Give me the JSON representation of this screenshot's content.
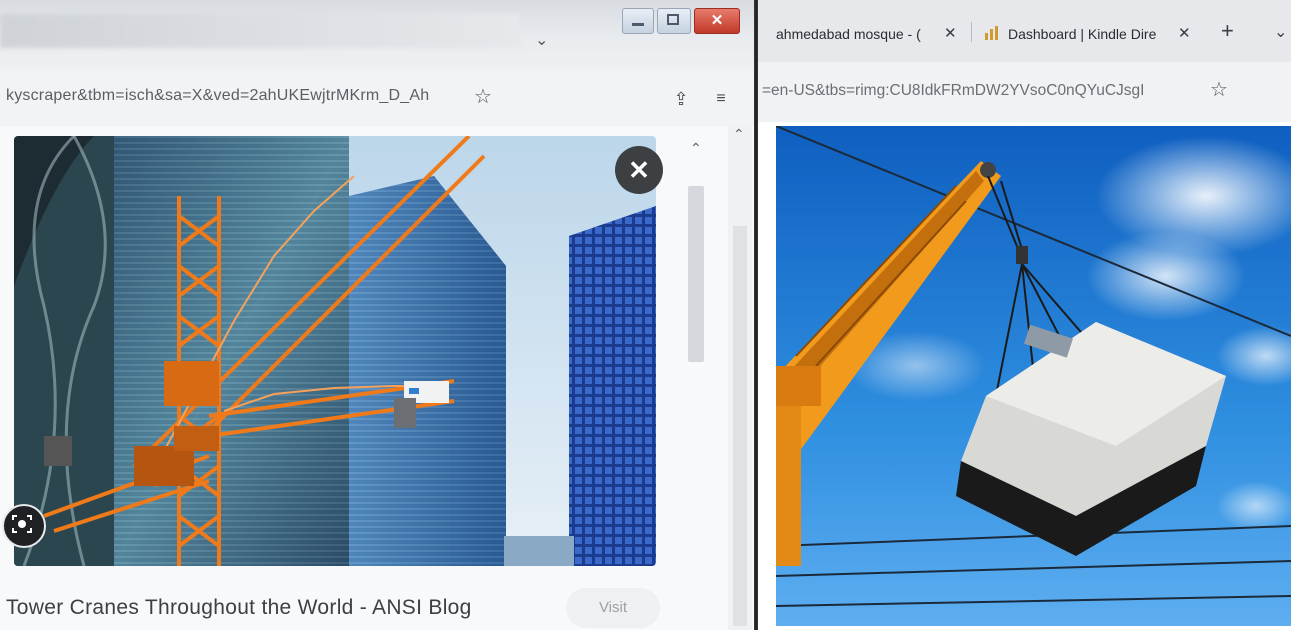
{
  "left_window": {
    "url": "kyscraper&tbm=isch&sa=X&ved=2ahUKEwjtrMKrm_D_Ah",
    "result": {
      "caption": "Tower Cranes Throughout the World - ANSI Blog",
      "visit_label": "Visit"
    }
  },
  "right_window": {
    "tabs": [
      {
        "label": "ahmedabad mosque - (",
        "icon": "google-g-icon"
      },
      {
        "label": "Dashboard | Kindle Dire",
        "icon": "kdp-bar-chart-icon"
      }
    ],
    "url": "=en-US&tbs=rimg:CU8IdkFRmDW2YVsoC0nQYuCJsgI"
  },
  "colors": {
    "crane_orange": "#f07a1a",
    "sky_blue": "#2f8fe0",
    "close_red": "#c8402f"
  }
}
